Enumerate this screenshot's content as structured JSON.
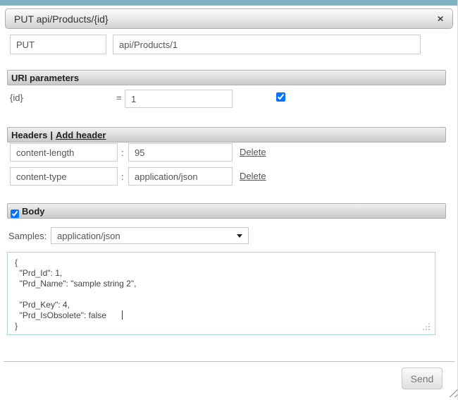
{
  "page": {
    "top_strip_color": "#7fb2c0"
  },
  "dialog": {
    "title": "PUT api/Products/{id}",
    "close_icon": "✕"
  },
  "request": {
    "method": "PUT",
    "url": "api/Products/1"
  },
  "uri_parameters": {
    "section_title": "URI parameters",
    "params": [
      {
        "name": "{id}",
        "equals": "=",
        "value": "1",
        "checked_attr": "checked"
      }
    ]
  },
  "headers": {
    "section_title": "Headers",
    "separator": "|",
    "add_link_label": "Add header",
    "colon": ":",
    "rows": [
      {
        "name": "content-length",
        "value": "95",
        "delete_label": "Delete"
      },
      {
        "name": "content-type",
        "value": "application/json",
        "delete_label": "Delete"
      }
    ]
  },
  "body": {
    "section_title": "Body",
    "checked_attr": "checked",
    "samples_label": "Samples:",
    "selected_sample": "application/json",
    "content": "{\n  \"Prd_Id\": 1,\n  \"Prd_Name\": \"sample string 2\",\n\n  \"Prd_Key\": 4,\n  \"Prd_IsObsolete\": false\n}"
  },
  "footer": {
    "send_label": "Send"
  }
}
